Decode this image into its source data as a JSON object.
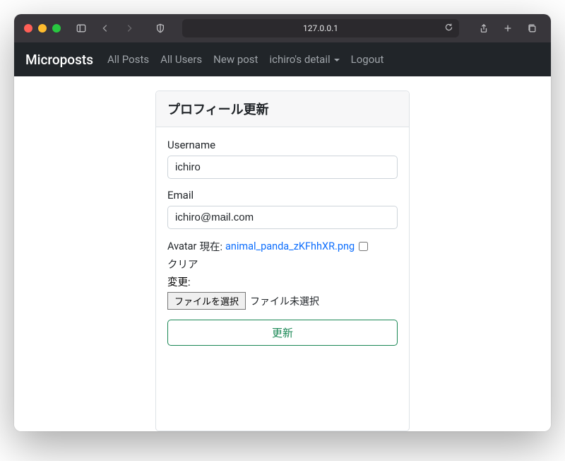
{
  "browser": {
    "address": "127.0.0.1"
  },
  "navbar": {
    "brand": "Microposts",
    "links": {
      "all_posts": "All Posts",
      "all_users": "All Users",
      "new_post": "New post",
      "user_detail": "ichiro's detail",
      "logout": "Logout"
    }
  },
  "card": {
    "title": "プロフィール更新",
    "username_label": "Username",
    "username_value": "ichiro",
    "email_label": "Email",
    "email_value": "ichiro@mail.com",
    "avatar_label": "Avatar",
    "avatar_current_label": "現在:",
    "avatar_filename": "animal_panda_zKFhhXR.png",
    "clear_label": "クリア",
    "change_label": "変更:",
    "file_button": "ファイルを選択",
    "file_status": "ファイル未選択",
    "submit": "更新"
  }
}
